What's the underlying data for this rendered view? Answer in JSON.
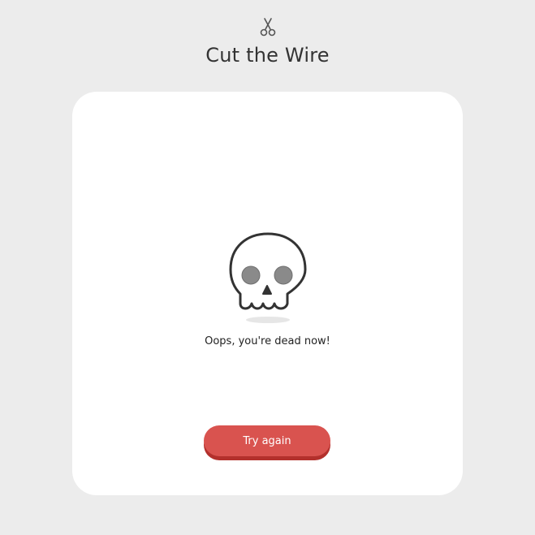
{
  "header": {
    "icon": "scissors-icon",
    "title": "Cut the Wire"
  },
  "result": {
    "icon": "skull-icon",
    "message": "Oops, you're dead now!",
    "retry_label": "Try again"
  },
  "colors": {
    "background": "#ececec",
    "card": "#ffffff",
    "button": "#d9534f",
    "button_shadow": "#b3302c"
  }
}
